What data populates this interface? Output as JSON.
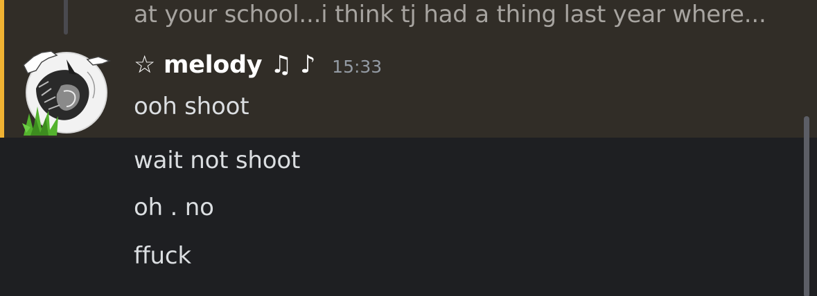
{
  "previous_message": {
    "text": "at your school...i think tj had a thing last year where..."
  },
  "message_group": {
    "username": "☆ melody ♫ ♪",
    "timestamp": "15:33",
    "highlight_color": "#f0b232",
    "avatar_icon": "user-avatar"
  },
  "messages": [
    {
      "text": "ooh shoot"
    },
    {
      "text": "wait not shoot"
    },
    {
      "text": "oh . no"
    },
    {
      "text": "ffuck"
    }
  ],
  "colors": {
    "background": "#1e1f22",
    "highlight_background": "#312d27",
    "text": "#dbdee1",
    "username": "#ffffff",
    "timestamp": "#949ba4"
  }
}
